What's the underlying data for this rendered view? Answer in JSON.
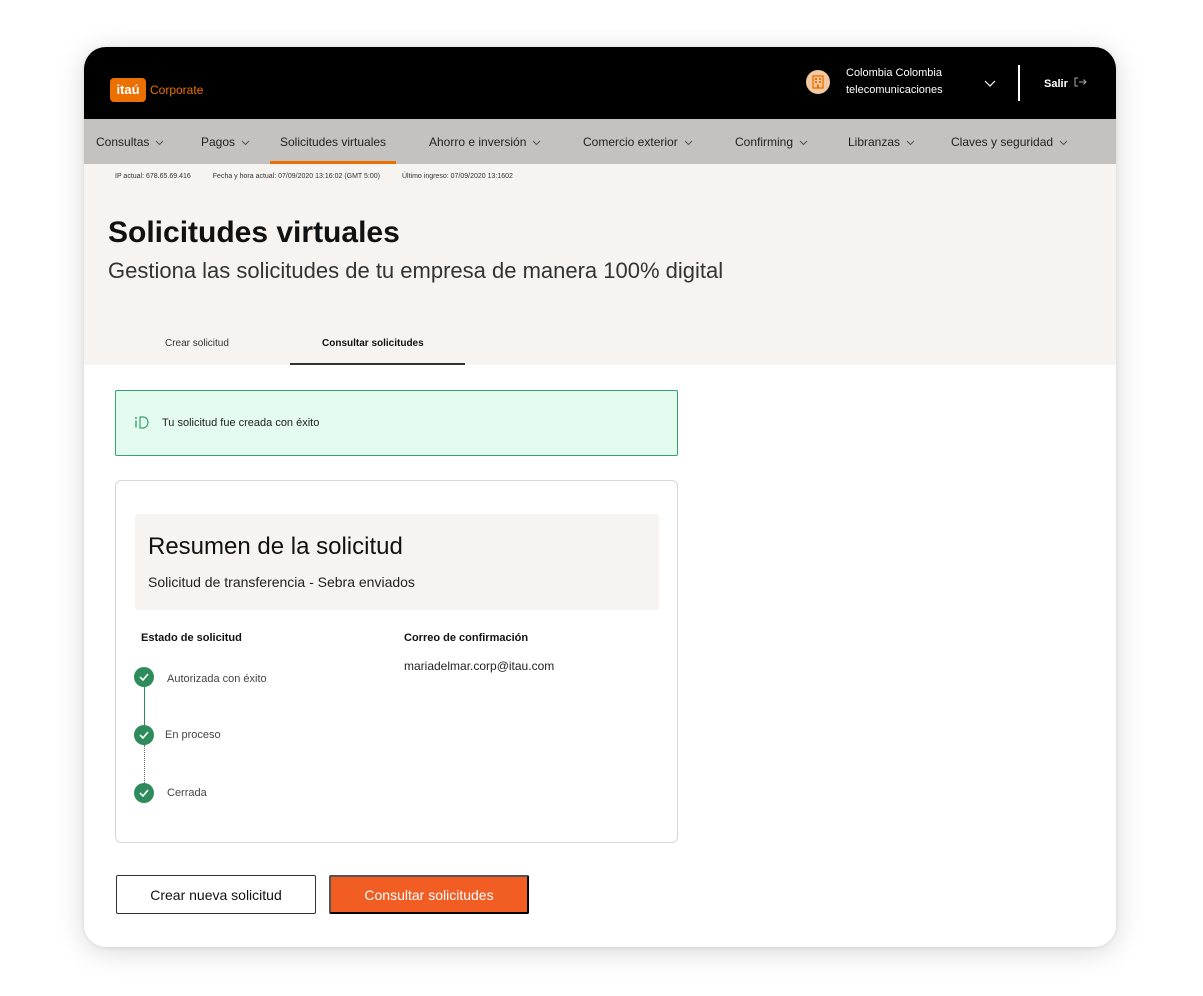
{
  "header": {
    "logo_text": "itaú",
    "logo_suffix": "Corporate",
    "company_line1": "Colombia Colombia",
    "company_line2": "telecomunicaciones",
    "logout_label": "Salir"
  },
  "nav": {
    "items": [
      {
        "label": "Consultas",
        "has_chevron": true
      },
      {
        "label": "Pagos",
        "has_chevron": true
      },
      {
        "label": "Solicitudes virtuales",
        "has_chevron": false,
        "active": true
      },
      {
        "label": "Ahorro e inversión",
        "has_chevron": true
      },
      {
        "label": "Comercio exterior",
        "has_chevron": true
      },
      {
        "label": "Confirming",
        "has_chevron": true
      },
      {
        "label": "Libranzas",
        "has_chevron": true
      },
      {
        "label": "Claves y seguridad",
        "has_chevron": true
      }
    ]
  },
  "meta": {
    "ip": "IP actual: 678.65.69.416",
    "datetime": "Fecha y hora actual: 07/09/2020 13:16:02 (GMT 5:00)",
    "last_login": "Último ingreso: 07/09/2020 13:1602"
  },
  "page": {
    "title": "Solicitudes virtuales",
    "subtitle": "Gestiona las solicitudes de tu empresa de manera 100% digital"
  },
  "tabs": [
    {
      "label": "Crear solicitud",
      "active": false
    },
    {
      "label": "Consultar solicitudes",
      "active": true
    }
  ],
  "alert": {
    "message": "Tu solicitud fue creada con éxito"
  },
  "summary": {
    "title": "Resumen de la solicitud",
    "subtitle": "Solicitud de transferencia - Sebra enviados",
    "status_heading": "Estado de solicitud",
    "email_heading": "Correo de confirmación",
    "email": "mariadelmar.corp@itau.com",
    "steps": [
      {
        "label": "Autorizada con éxito",
        "done": true
      },
      {
        "label": "En proceso",
        "done": true
      },
      {
        "label": "Cerrada",
        "done": true
      }
    ]
  },
  "buttons": {
    "create_new": "Crear nueva solicitud",
    "consult": "Consultar solicitudes"
  },
  "colors": {
    "brand_orange": "#ec7000",
    "primary_button": "#f25d23",
    "success_green": "#2e8b5b",
    "alert_bg": "#e4fbef"
  },
  "icons": {
    "company": "building-icon",
    "logout": "logout-icon",
    "alert": "info-icon",
    "step": "check-icon",
    "dropdown": "chevron-down-icon"
  }
}
